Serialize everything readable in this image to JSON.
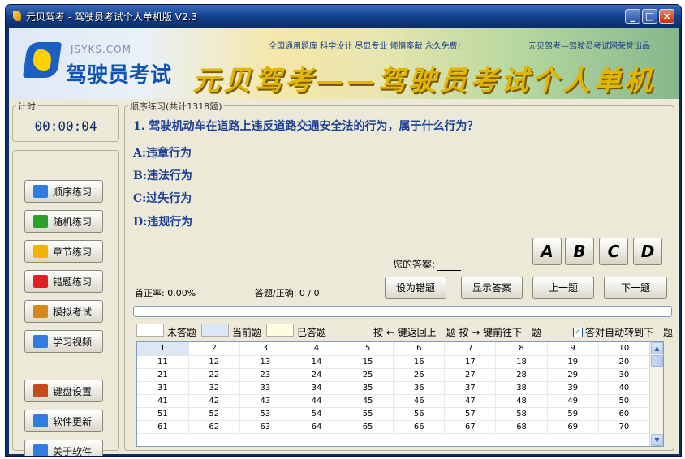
{
  "window": {
    "title": "元贝驾考 - 驾驶员考试个人单机版 V2.3",
    "min": "_",
    "max": "□",
    "close": "×"
  },
  "banner": {
    "logo_en": "JSYKS.COM",
    "logo_cn": "驾驶员考试",
    "slogan": "全国通用题库 科学设计 尽显专业 倾情奉献 永久免费!",
    "slogan_right": "元贝驾考—驾驶员考试网荣誉出品",
    "big_title": "元贝驾考——驾驶员考试个人单机版"
  },
  "timer": {
    "caption": "计时",
    "value": "00:00:04"
  },
  "nav": [
    {
      "label": "顺序练习",
      "icon": "pencil-icon",
      "color": "#2f7de0"
    },
    {
      "label": "随机练习",
      "icon": "shuffle-icon",
      "color": "#2aa12a"
    },
    {
      "label": "章节练习",
      "icon": "folder-icon",
      "color": "#f2b300"
    },
    {
      "label": "错题练习",
      "icon": "flag-icon",
      "color": "#e02020"
    },
    {
      "label": "模拟考试",
      "icon": "calendar-icon",
      "color": "#d38a1c"
    },
    {
      "label": "学习视频",
      "icon": "video-icon",
      "color": "#2f7de0"
    },
    {
      "label": "键盘设置",
      "icon": "brush-icon",
      "color": "#c84a1a"
    },
    {
      "label": "软件更新",
      "icon": "update-icon",
      "color": "#2f7de0"
    },
    {
      "label": "关于软件",
      "icon": "info-icon",
      "color": "#2f7de0"
    }
  ],
  "practice": {
    "caption": "顺序练习(共计1318题)",
    "question": "1. 驾驶机动车在道路上违反道路交通安全法的行为，属于什么行为？",
    "options": [
      "A:违章行为",
      "B:违法行为",
      "C:过失行为",
      "D:违规行为"
    ],
    "answer_label": "您的答案:",
    "answer_buttons": [
      "A",
      "B",
      "C",
      "D"
    ],
    "accuracy": "首正率: 0.00%",
    "answered": "答题/正确: 0 / 0",
    "set_wrong": "设为错题",
    "show_answer": "显示答案",
    "prev": "上一题",
    "next": "下一题",
    "progress": 0.0,
    "legend": [
      "未答题",
      "当前题",
      "已答题"
    ],
    "legend_colors": [
      "#ffffff",
      "#dbe7f5",
      "#fffde0"
    ],
    "hint": "按 ← 键返回上一题  按 → 键前往下一题",
    "auto_next": "答对自动转到下一题",
    "auto_next_checked": "✓"
  },
  "grid": [
    [
      "1",
      "2",
      "3",
      "4",
      "5",
      "6",
      "7",
      "8",
      "9",
      "10"
    ],
    [
      "11",
      "12",
      "13",
      "14",
      "15",
      "16",
      "17",
      "18",
      "19",
      "20"
    ],
    [
      "21",
      "22",
      "23",
      "24",
      "25",
      "26",
      "27",
      "28",
      "29",
      "30"
    ],
    [
      "31",
      "32",
      "33",
      "34",
      "35",
      "36",
      "37",
      "38",
      "39",
      "40"
    ],
    [
      "41",
      "42",
      "43",
      "44",
      "45",
      "46",
      "47",
      "48",
      "49",
      "50"
    ],
    [
      "51",
      "52",
      "53",
      "54",
      "55",
      "56",
      "57",
      "58",
      "59",
      "60"
    ],
    [
      "61",
      "62",
      "63",
      "64",
      "65",
      "66",
      "67",
      "68",
      "69",
      "70"
    ]
  ]
}
